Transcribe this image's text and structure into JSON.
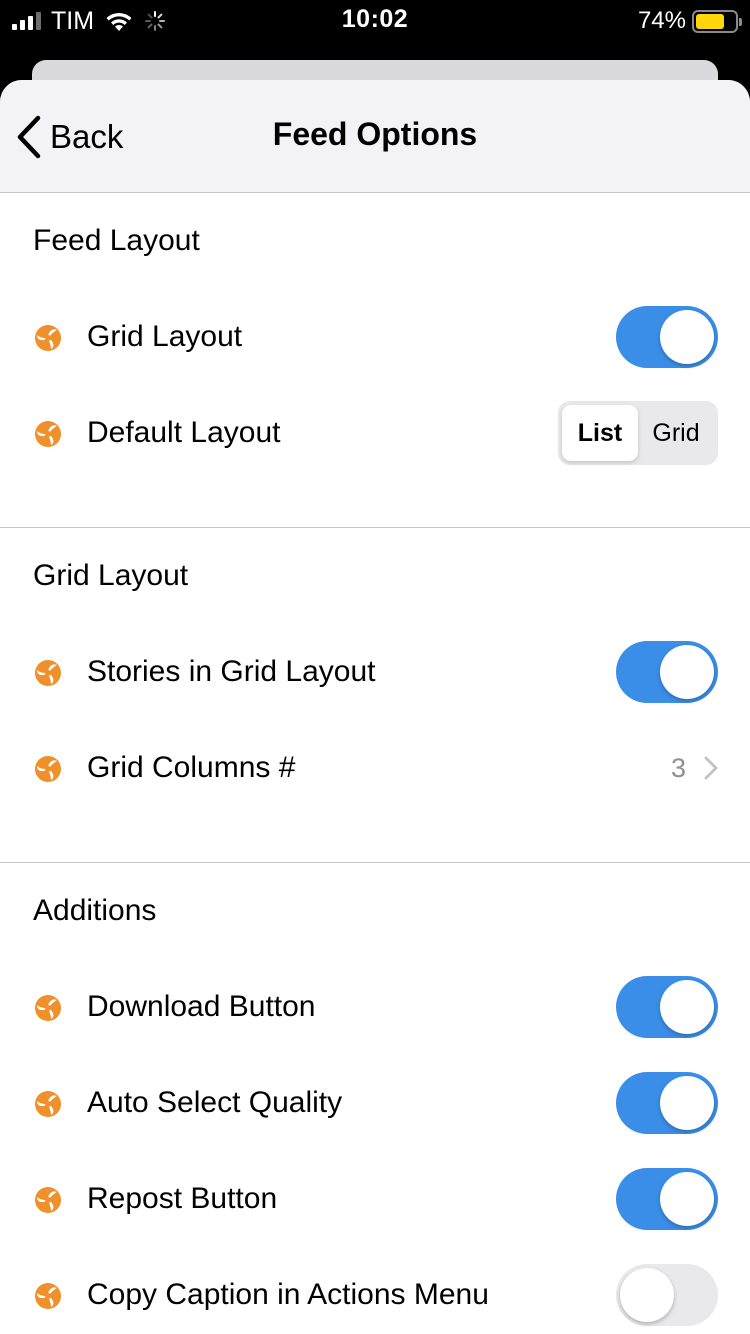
{
  "status_bar": {
    "carrier": "TIM",
    "time": "10:02",
    "battery_percent": "74%",
    "battery_level": 0.74,
    "battery_color": "#ffd60a"
  },
  "nav": {
    "back_label": "Back",
    "title": "Feed Options"
  },
  "accent_color": "#3a8ee8",
  "icon_color": "#f0902a",
  "sections": {
    "feed_layout": {
      "title": "Feed Layout",
      "grid_layout": {
        "label": "Grid Layout",
        "on": true
      },
      "default_layout": {
        "label": "Default Layout",
        "options": [
          "List",
          "Grid"
        ],
        "selected": "List"
      }
    },
    "grid_layout": {
      "title": "Grid Layout",
      "stories_grid": {
        "label": "Stories in Grid Layout",
        "on": true
      },
      "grid_columns": {
        "label": "Grid Columns #",
        "value": "3"
      }
    },
    "additions": {
      "title": "Additions",
      "download_button": {
        "label": "Download Button",
        "on": true
      },
      "auto_select_quality": {
        "label": "Auto Select Quality",
        "on": true
      },
      "repost_button": {
        "label": "Repost Button",
        "on": true
      },
      "copy_caption": {
        "label": "Copy Caption in Actions Menu",
        "on": false
      }
    }
  }
}
